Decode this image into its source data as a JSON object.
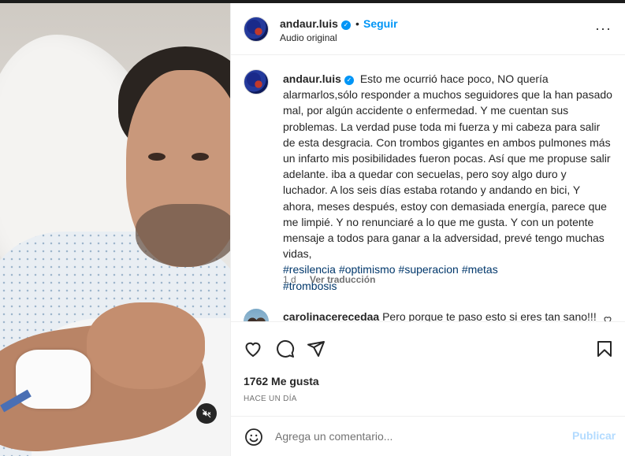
{
  "post": {
    "username": "andaur.luis",
    "follow_label": "Seguir",
    "dot": "•",
    "audio_label": "Audio original",
    "more_label": "···",
    "caption_text": "Esto me ocurrió hace poco, NO quería alarmarlos,sólo responder a muchos seguidores que la han pasado mal, por algún accidente o enfermedad. Y me cuentan sus problemas. La verdad puse toda mi fuerza y mi cabeza para salir de esta desgracia. Con trombos gigantes en ambos pulmones más un infarto mis posibilidades fueron pocas. Así que me propuse salir adelante. iba a quedar con secuelas, pero soy algo duro y luchador. A los seis días estaba rotando y andando en bici, Y ahora, meses después, estoy con demasiada energía, parece que me limpié. Y no renunciaré a lo que me gusta. Y con un potente mensaje a todos para ganar a la adversidad, prevé tengo muchas vidas,",
    "hashtags": [
      "#resilencia",
      "#optimismo",
      "#superacion",
      "#metas",
      "#trombosis"
    ],
    "age": "1 d",
    "translate_label": "Ver traducción"
  },
  "comment": {
    "username": "carolinacerecedaa",
    "text": "Pero porque te paso esto si eres tan sano!!!"
  },
  "engagement": {
    "likes": "1762 Me gusta",
    "time": "HACE UN DÍA"
  },
  "composer": {
    "placeholder": "Agrega un comentario...",
    "publish_label": "Publicar"
  },
  "colors": {
    "accent": "#0095f6",
    "publish_disabled": "#b3dbff",
    "hashtag": "#00376b"
  }
}
